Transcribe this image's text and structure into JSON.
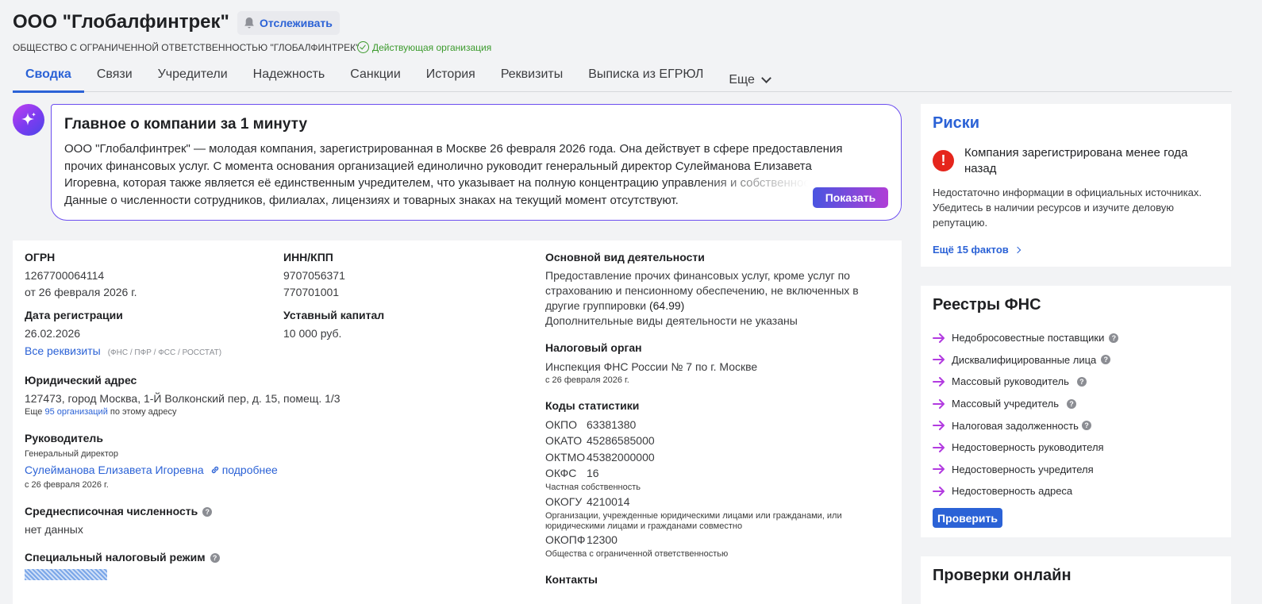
{
  "header": {
    "title": "ООО \"Глобалфинтрек\"",
    "follow_label": "Отслеживать",
    "full_name": "ОБЩЕСТВО С ОГРАНИЧЕННОЙ ОТВЕТСТВЕННОСТЬЮ \"ГЛОБАЛФИНТРЕК\"",
    "status": "Действующая организация",
    "status_color": "#3b9a2c"
  },
  "tabs": [
    {
      "label": "Сводка",
      "active": true
    },
    {
      "label": "Связи"
    },
    {
      "label": "Учредители"
    },
    {
      "label": "Надежность"
    },
    {
      "label": "Санкции"
    },
    {
      "label": "История"
    },
    {
      "label": "Реквизиты"
    },
    {
      "label": "Выписка из ЕГРЮЛ"
    },
    {
      "label": "Еще"
    }
  ],
  "ai_summary": {
    "title": "Главное о компании за 1 минуту",
    "text": "ООО \"Глобалфинтрек\" — молодая компания, зарегистрированная в Москве 26 февраля 2026 года. Она действует в сфере предоставления прочих финансовых услуг. С момента основания организацией единолично руководит генеральный директор Сулейманова Елизавета Игоревна, которая также является её единственным учредителем, что указывает на полную концентрацию управления и собственности. Данные о численности сотрудников, филиалах, лицензиях и товарных знаках на текущий момент отсутствуют.",
    "show_button": "Показать"
  },
  "details": {
    "ogrn_label": "ОГРН",
    "ogrn": "1267700064114",
    "ogrn_date": "от 26 февраля 2026 г.",
    "inn_kpp_label": "ИНН/КПП",
    "inn": "9707056371",
    "kpp": "770701001",
    "reg_date_label": "Дата регистрации",
    "reg_date": "26.02.2026",
    "capital_label": "Уставный капитал",
    "capital": "10 000 руб.",
    "all_requisites": "Все реквизиты",
    "requisites_note": "(ФНС / ПФР / ФСС / РОССТАТ)",
    "address_label": "Юридический адрес",
    "address": "127473, город Москва, 1-Й Волконский пер, д. 15, помещ. 1/3",
    "address_more_prefix": "Еще",
    "address_more_link": "95 организаций",
    "address_more_suffix": "по этому адресу",
    "manager_label": "Руководитель",
    "manager_role": "Генеральный директор",
    "manager_name": "Сулейманова Елизавета Игоревна",
    "manager_more": "подробнее",
    "manager_date": "с 26 февраля 2026 г.",
    "headcount_label": "Среднесписочная численность",
    "headcount": "нет данных",
    "tax_mode_label": "Специальный налоговый режим",
    "activity_label": "Основной вид деятельности",
    "activity_l1": "Предоставление прочих финансовых услуг, кроме услуг по",
    "activity_l2": "страхованию и пенсионному обеспечению, не включенных в",
    "activity_l3": "другие группировки",
    "activity_code": "(64.99)",
    "activity_extra": "Дополнительные виды деятельности не указаны",
    "tax_org_label": "Налоговый орган",
    "tax_org": "Инспекция ФНС России № 7 по г. Москве",
    "tax_org_date": "с 26 февраля 2026 г.",
    "stats_label": "Коды статистики",
    "okpo_k": "ОКПО",
    "okpo_v": "63381380",
    "okato_k": "ОКАТО",
    "okato_v": "45286585000",
    "oktmo_k": "ОКТМО",
    "oktmo_v": "45382000000",
    "okfs_k": "ОКФС",
    "okfs_v": "16",
    "okfs_note": "Частная собственность",
    "okogu_k": "ОКОГУ",
    "okogu_v": "4210014",
    "okogu_note_l1": "Организации, учрежденные юридическими лицами или гражданами, или",
    "okogu_note_l2": "юридическими лицами и гражданами совместно",
    "okopf_k": "ОКОПФ",
    "okopf_v": "12300",
    "okopf_note": "Общества с ограниченной ответственностью",
    "contacts_label": "Контакты"
  },
  "risks": {
    "title": "Риски",
    "head": "Компания зарегистрирована менее года назад",
    "text": "Недостаточно информации в официальных источниках. Убедитесь в наличии ресурсов и изучите деловую репутацию.",
    "more": "Ещё 15 фактов",
    "alert_color": "#e5251c"
  },
  "fns": {
    "title": "Реестры ФНС",
    "items": [
      {
        "label": "Недобросовестные поставщики",
        "help": true
      },
      {
        "label": "Дисквалифицированные лица",
        "help": true
      },
      {
        "label": "Массовый руководитель",
        "help": true
      },
      {
        "label": "Массовый учредитель",
        "help": true
      },
      {
        "label": "Налоговая задолженность",
        "help": true
      },
      {
        "label": "Недостоверность руководителя",
        "help": false
      },
      {
        "label": "Недостоверность учредителя",
        "help": false
      },
      {
        "label": "Недостоверность адреса",
        "help": false
      }
    ],
    "check_button": "Проверить"
  },
  "checks": {
    "title": "Проверки онлайн"
  },
  "colors": {
    "accent": "#2b62d6",
    "arrow": "#b23be0"
  }
}
